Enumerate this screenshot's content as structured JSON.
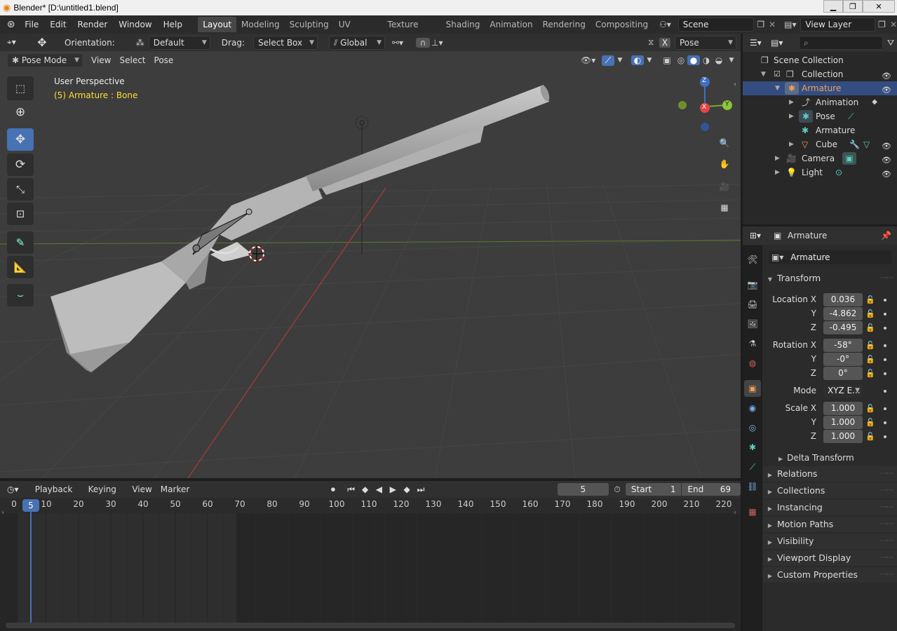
{
  "window": {
    "title": "Blender* [D:\\untitled1.blend]"
  },
  "menu": [
    "File",
    "Edit",
    "Render",
    "Window",
    "Help"
  ],
  "workspaces": [
    "Layout",
    "Modeling",
    "Sculpting",
    "UV Editing",
    "Texture Paint",
    "Shading",
    "Animation",
    "Rendering",
    "Compositing"
  ],
  "scene": {
    "name": "Scene",
    "view_layer": "View Layer"
  },
  "tool_header": {
    "orientation_label": "Orientation:",
    "orientation_value": "Default",
    "drag_label": "Drag:",
    "drag_value": "Select Box",
    "transform_value": "Global",
    "x_label": "X",
    "pose_options": "Pose Options"
  },
  "viewport_header": {
    "mode": "Pose Mode",
    "view": "View",
    "select": "Select",
    "pose": "Pose"
  },
  "viewport": {
    "perspective": "User Perspective",
    "object_info": "(5) Armature : Bone",
    "axis_z": "Z",
    "axis_x": "X",
    "axis_y": "Y"
  },
  "outliner": {
    "root": "Scene Collection",
    "items": [
      {
        "label": "Collection",
        "icon": "collection-icon"
      },
      {
        "label": "Armature",
        "icon": "armature-icon"
      },
      {
        "label": "Animation",
        "icon": "animation-icon"
      },
      {
        "label": "Pose",
        "icon": "pose-icon"
      },
      {
        "label": "Armature",
        "icon": "armature-data-icon"
      },
      {
        "label": "Cube",
        "icon": "mesh-icon"
      },
      {
        "label": "Camera",
        "icon": "camera-icon"
      },
      {
        "label": "Light",
        "icon": "light-icon"
      }
    ]
  },
  "properties": {
    "header_object": "Armature",
    "object_name": "Armature",
    "transform": "Transform",
    "location_x_label": "Location X",
    "y_label": "Y",
    "z_label": "Z",
    "location": [
      "0.036",
      "-4.862",
      "-0.495"
    ],
    "rotation_x_label": "Rotation X",
    "rotation": [
      "-58°",
      "-0°",
      "0°"
    ],
    "mode_label": "Mode",
    "mode_value": "XYZ E...",
    "scale_x_label": "Scale X",
    "scale": [
      "1.000",
      "1.000",
      "1.000"
    ],
    "delta": "Delta Transform",
    "sections": [
      "Relations",
      "Collections",
      "Instancing",
      "Motion Paths",
      "Visibility",
      "Viewport Display",
      "Custom Properties"
    ]
  },
  "timeline": {
    "playback": "Playback",
    "keying": "Keying",
    "view": "View",
    "marker": "Marker",
    "current_frame": "5",
    "start_label": "Start",
    "start": "1",
    "end_label": "End",
    "end": "69",
    "ruler": [
      "0",
      "10",
      "20",
      "30",
      "40",
      "50",
      "60",
      "70",
      "80",
      "90",
      "100",
      "110",
      "120",
      "130",
      "140",
      "150",
      "160",
      "170",
      "180",
      "190",
      "200",
      "210",
      "220"
    ],
    "playhead": "5"
  }
}
